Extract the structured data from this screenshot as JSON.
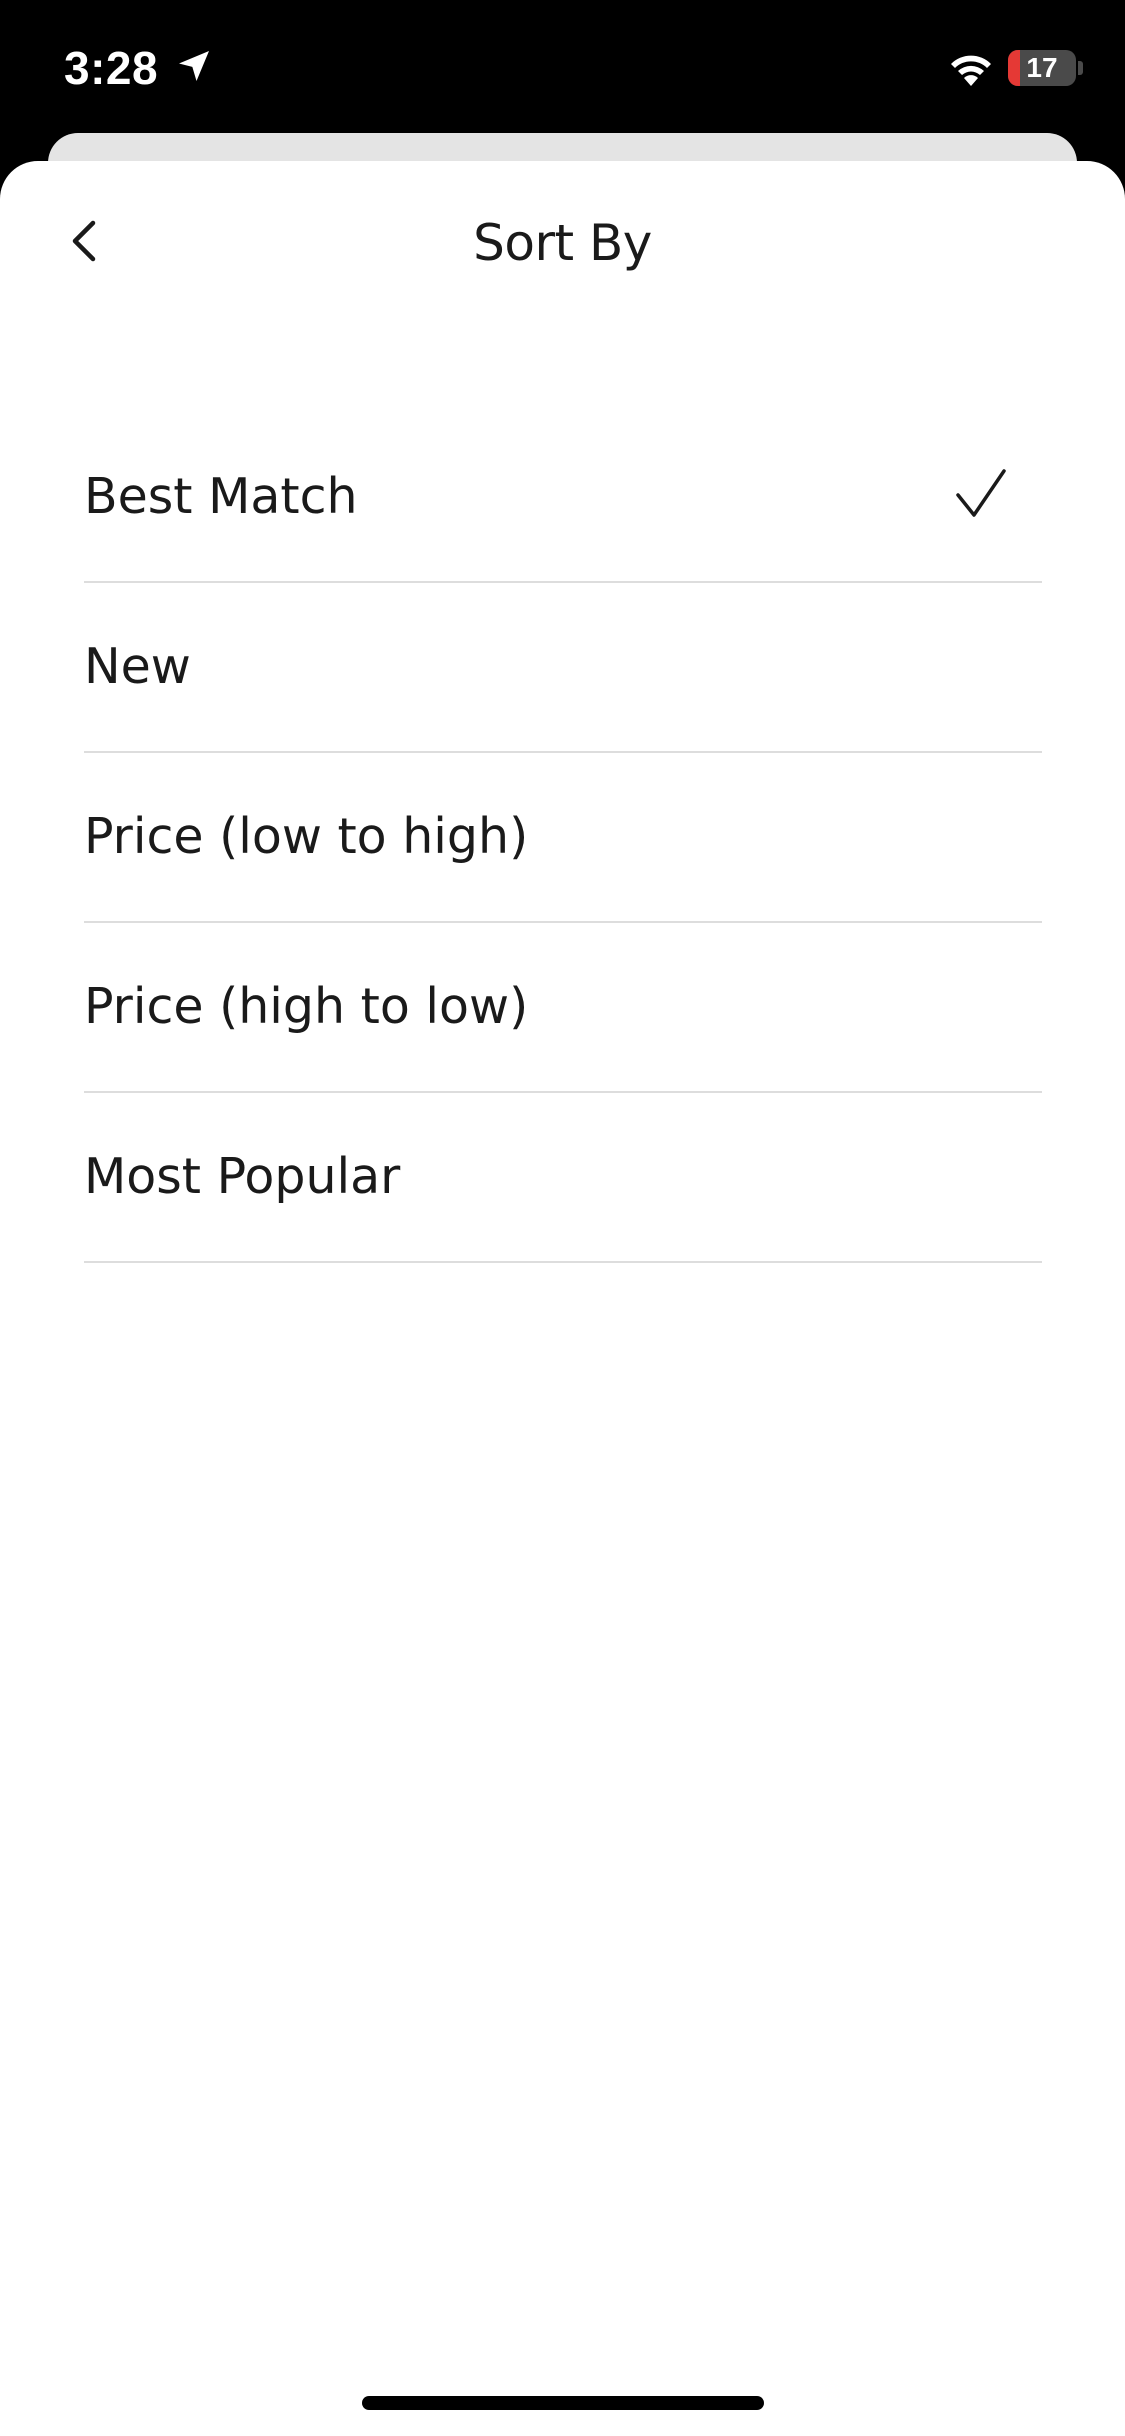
{
  "status_bar": {
    "time": "3:28",
    "battery_level": "17",
    "battery_fraction": 0.17,
    "battery_color": "#e53935",
    "icons": [
      "location-arrow-icon",
      "wifi-icon",
      "battery-icon"
    ]
  },
  "sheet": {
    "title": "Sort By",
    "back_icon": "chevron-left-icon"
  },
  "sort_options": [
    {
      "label": "Best Match",
      "selected": true
    },
    {
      "label": "New",
      "selected": false
    },
    {
      "label": "Price (low to high)",
      "selected": false
    },
    {
      "label": "Price (high to low)",
      "selected": false
    },
    {
      "label": "Most Popular",
      "selected": false
    }
  ],
  "selected_icon": "checkmark-icon"
}
